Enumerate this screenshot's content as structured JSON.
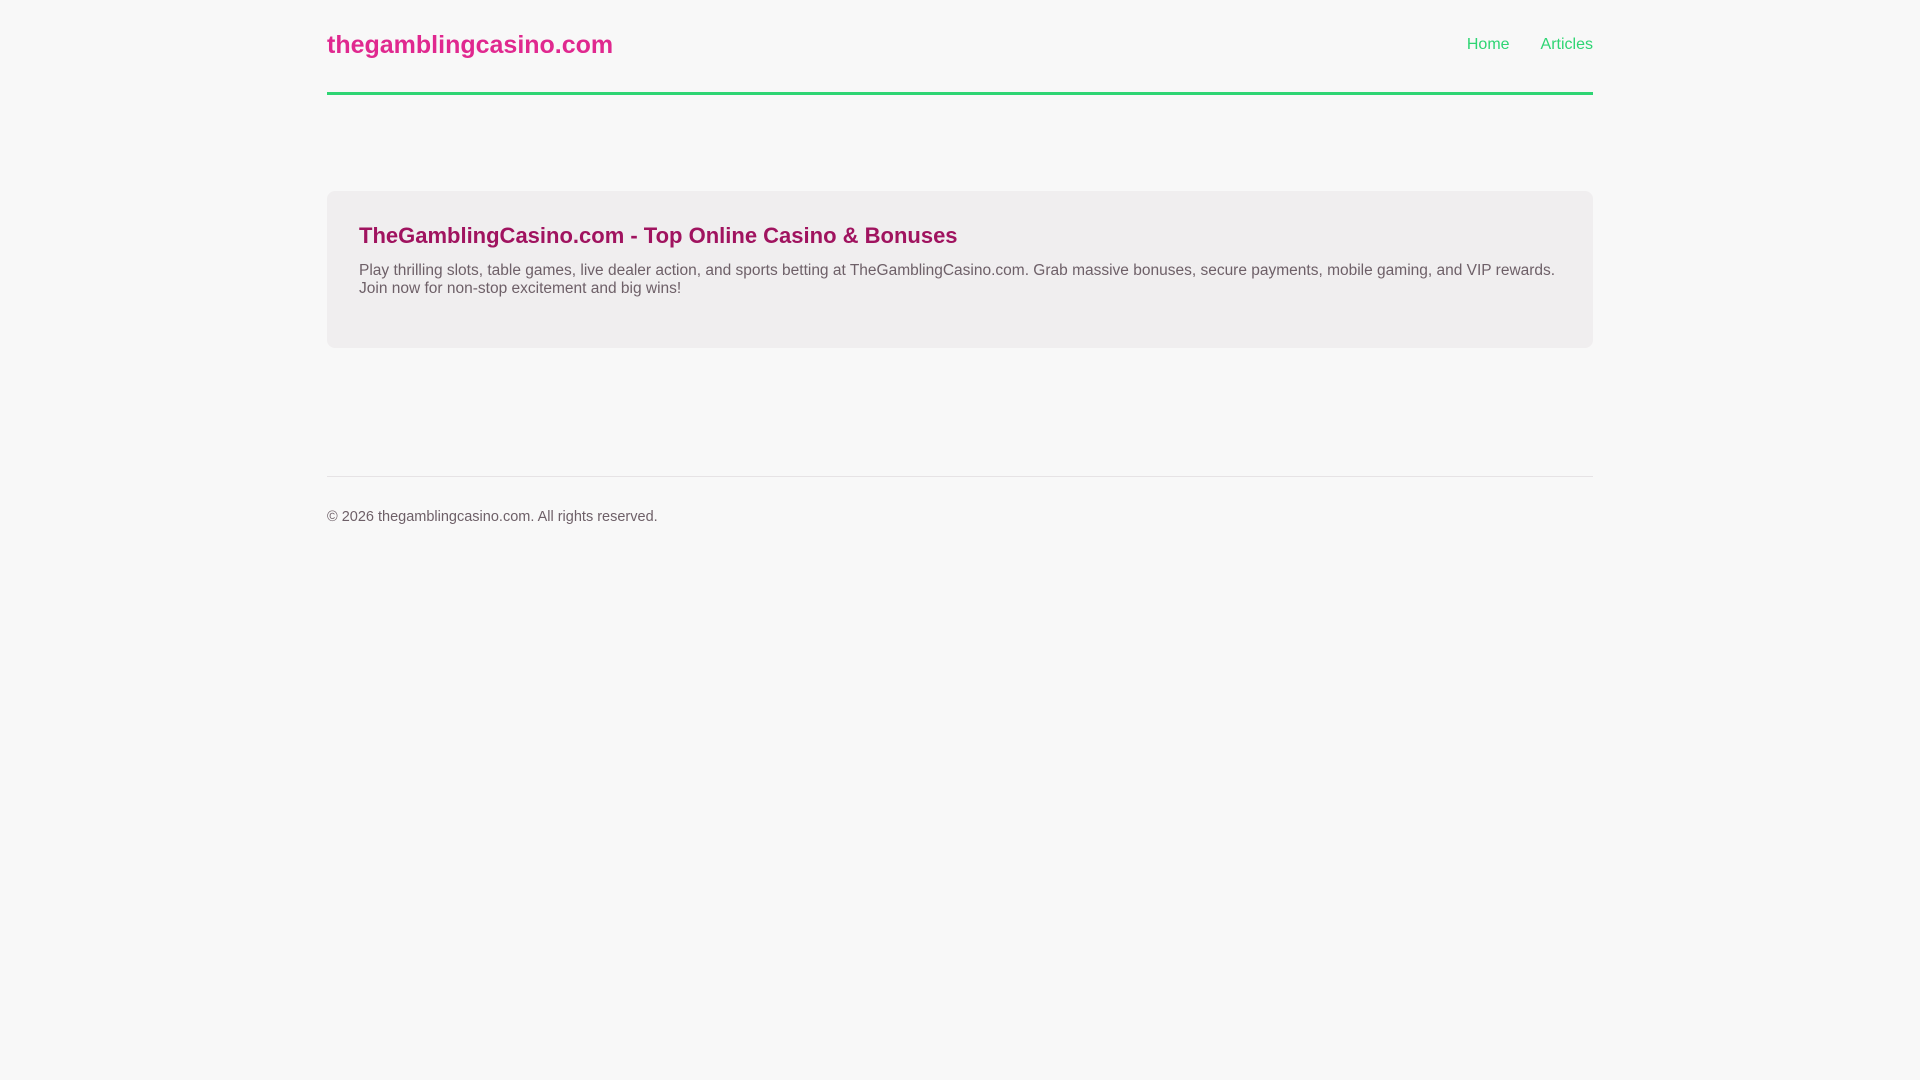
{
  "header": {
    "logo": "thegamblingcasino.com",
    "nav": [
      {
        "label": "Home"
      },
      {
        "label": "Articles"
      }
    ]
  },
  "hero": {
    "title": "TheGamblingCasino.com - Top Online Casino & Bonuses",
    "description": "Play thrilling slots, table games, live dealer action, and sports betting at TheGamblingCasino.com. Grab massive bonuses, secure payments, mobile gaming, and VIP rewards. Join now for non-stop excitement and big wins!"
  },
  "footer": {
    "copyright": "© 2026 thegamblingcasino.com. All rights reserved."
  },
  "colors": {
    "brand": "#e0288f",
    "title": "#a0135f",
    "accent": "#2ed573",
    "background": "#f8f8f8",
    "card": "#f0eeef"
  }
}
